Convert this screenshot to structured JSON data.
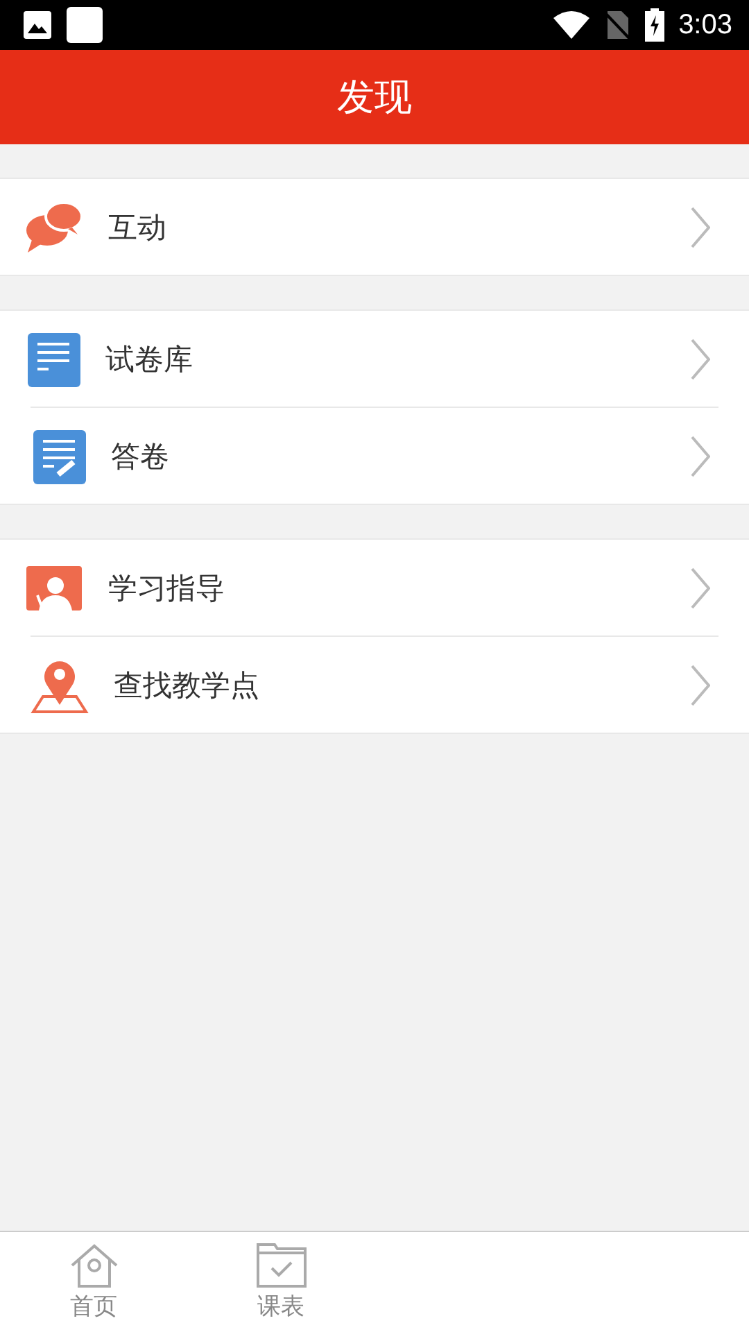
{
  "status_bar": {
    "time": "3:03"
  },
  "header": {
    "title": "发现"
  },
  "groups": [
    {
      "items": [
        {
          "kind": "chat",
          "label": "互动"
        }
      ]
    },
    {
      "items": [
        {
          "kind": "paper",
          "label": "试卷库"
        },
        {
          "kind": "answer",
          "label": "答卷"
        }
      ]
    },
    {
      "items": [
        {
          "kind": "guide",
          "label": "学习指导"
        },
        {
          "kind": "location",
          "label": "查找教学点"
        }
      ]
    }
  ],
  "tab_bar": {
    "tabs": [
      {
        "kind": "home",
        "label": "首页",
        "selected": false
      },
      {
        "kind": "schedule",
        "label": "课表",
        "selected": false
      }
    ]
  }
}
